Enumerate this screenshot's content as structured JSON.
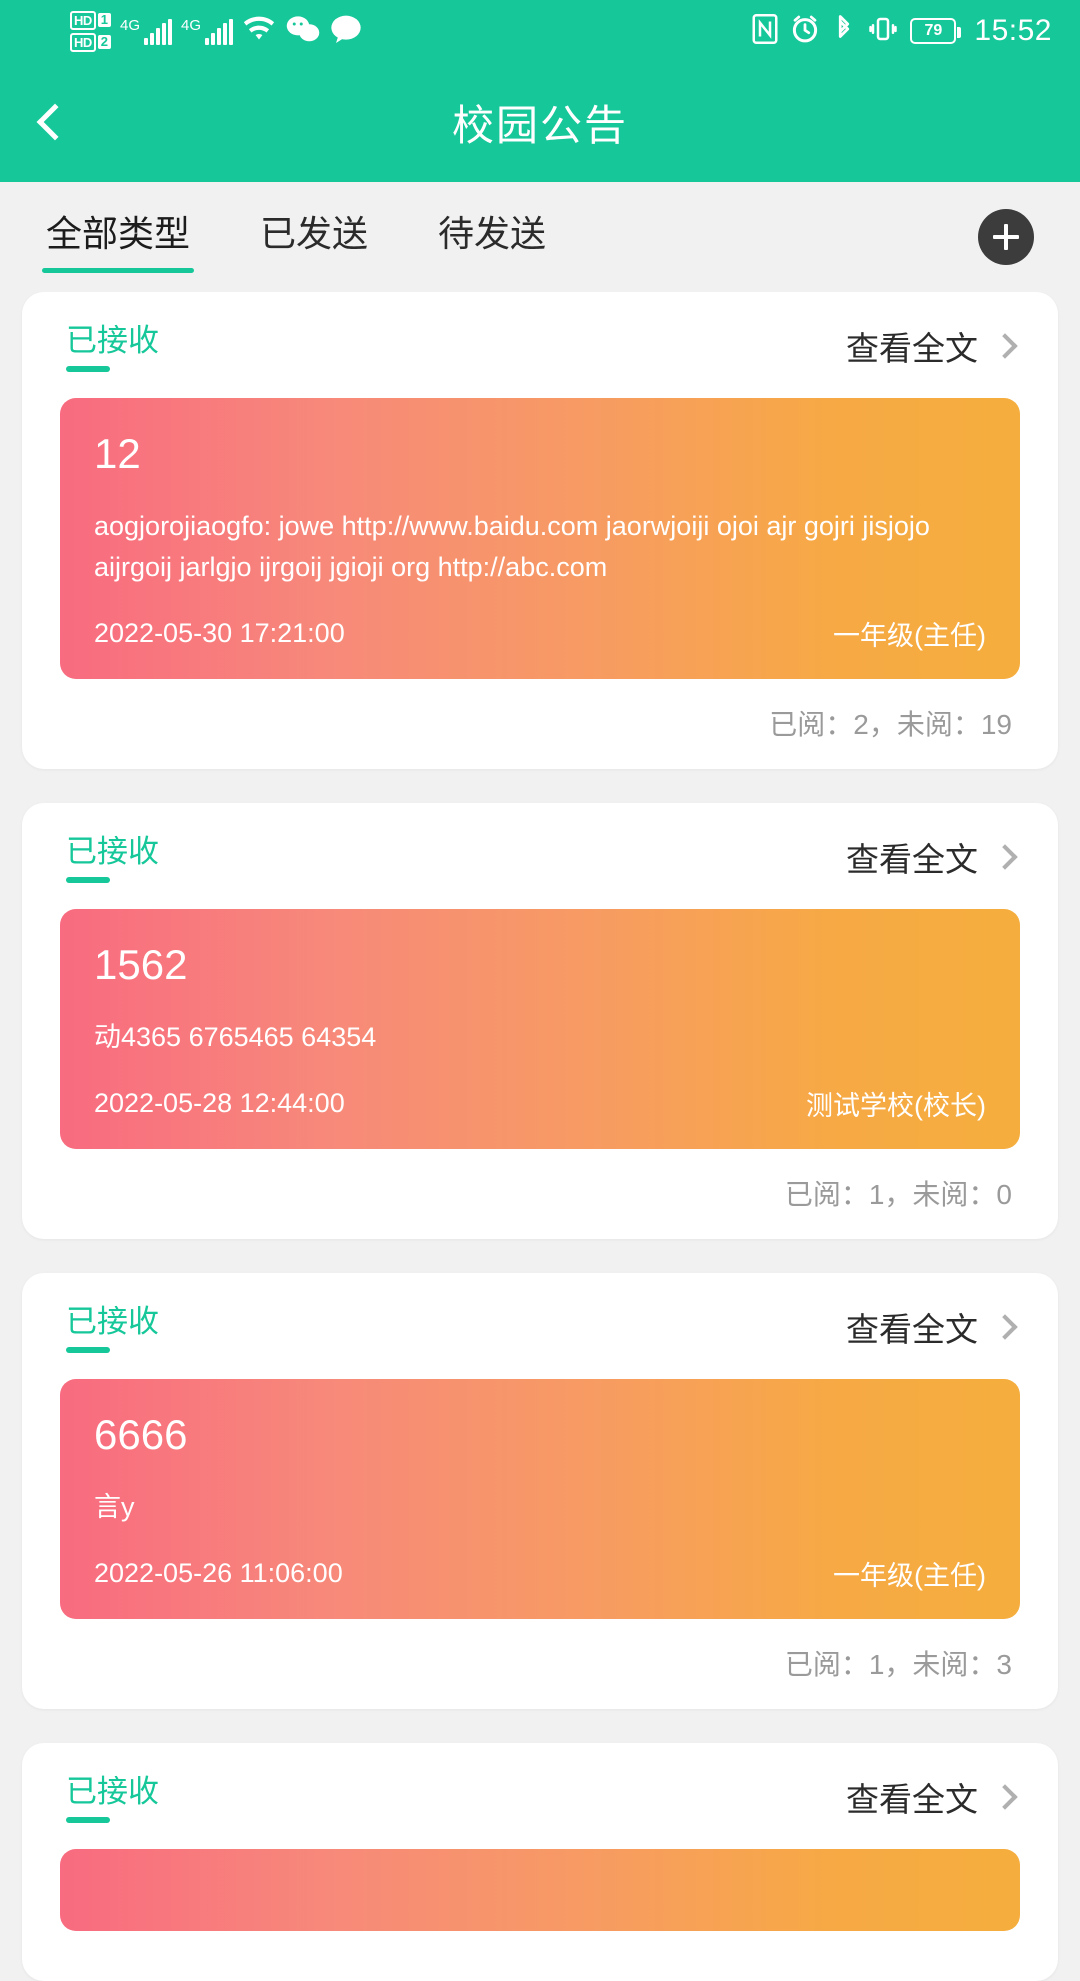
{
  "statusbar": {
    "hd1_label": "HD",
    "hd1_sim": "1",
    "hd2_label": "HD",
    "hd2_sim": "2",
    "net1": "4G",
    "net2": "4G",
    "wifi_icon": "wifi-icon",
    "wechat_icon": "wechat-icon",
    "message_icon": "message-bubble-icon",
    "nfc_icon": "nfc-icon",
    "alarm_icon": "alarm-icon",
    "bluetooth_icon": "bluetooth-icon",
    "vibrate_icon": "vibrate-icon",
    "battery_level": "79",
    "time": "15:52"
  },
  "appbar": {
    "back_icon": "back-chevron-icon",
    "title": "校园公告"
  },
  "tabs": [
    {
      "label": "全部类型",
      "active": true
    },
    {
      "label": "已发送",
      "active": false
    },
    {
      "label": "待发送",
      "active": false
    }
  ],
  "add_button": {
    "icon": "plus-icon",
    "label": "+"
  },
  "colors": {
    "brand_green": "#16C79A",
    "banner_gradient_start": "#F86B80",
    "banner_gradient_end": "#F5AE3D",
    "page_background": "#F1F1F1",
    "card_background": "#FFFFFF",
    "read_text": "#9A9A9A"
  },
  "labels": {
    "status_received": "已接收",
    "view_all": "查看全文"
  },
  "cards": [
    {
      "status": "已接收",
      "view_all": "查看全文",
      "title": "12",
      "body": "aogjorojiaogfo: jowe http://www.baidu.com jaorwjoiji ojoi ajr gojri jisjojo aijrgoij jarlgjo ijrgoij jgioji org http://abc.com",
      "date": "2022-05-30 17:21:00",
      "sender": "一年级(主任)",
      "read_info": "已阅：2，未阅：19"
    },
    {
      "status": "已接收",
      "view_all": "查看全文",
      "title": "1562",
      "body": "动4365 6765465 64354",
      "date": "2022-05-28 12:44:00",
      "sender": "测试学校(校长)",
      "read_info": "已阅：1，未阅：0"
    },
    {
      "status": "已接收",
      "view_all": "查看全文",
      "title": "6666",
      "body": "言y",
      "date": "2022-05-26 11:06:00",
      "sender": "一年级(主任)",
      "read_info": "已阅：1，未阅：3"
    },
    {
      "status": "已接收",
      "view_all": "查看全文",
      "title": "",
      "body": "",
      "date": "",
      "sender": "",
      "read_info": ""
    }
  ]
}
